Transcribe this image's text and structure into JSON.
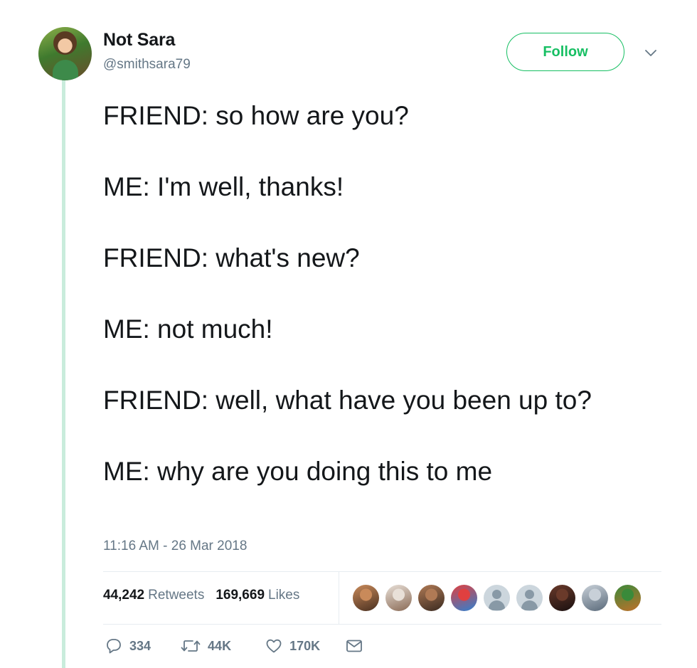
{
  "user": {
    "name": "Not Sara",
    "handle": "@smithsara79"
  },
  "follow_label": "Follow",
  "tweet": {
    "lines": [
      "FRIEND: so how are you?",
      "ME: I'm well, thanks!",
      "FRIEND: what's new?",
      "ME: not much!",
      "FRIEND: well, what have you been up to?",
      "ME: why are you doing this to me"
    ],
    "timestamp": "11:16 AM - 26 Mar 2018"
  },
  "stats": {
    "retweets_count": "44,242",
    "retweets_label": "Retweets",
    "likes_count": "169,669",
    "likes_label": "Likes"
  },
  "likers": [
    {
      "kind": "photo",
      "colors": [
        "#c98a5a",
        "#4a3020"
      ]
    },
    {
      "kind": "photo",
      "colors": [
        "#e8e0d8",
        "#8a6a55"
      ]
    },
    {
      "kind": "photo",
      "colors": [
        "#b07a55",
        "#3a2a20"
      ]
    },
    {
      "kind": "photo",
      "colors": [
        "#e04040",
        "#3080d0"
      ]
    },
    {
      "kind": "default"
    },
    {
      "kind": "default"
    },
    {
      "kind": "photo",
      "colors": [
        "#6a3a2a",
        "#1a1010"
      ]
    },
    {
      "kind": "photo",
      "colors": [
        "#c8d0d8",
        "#5a6a7a"
      ]
    },
    {
      "kind": "photo",
      "colors": [
        "#3a8a3a",
        "#c0702a"
      ]
    }
  ],
  "actions": {
    "replies": "334",
    "retweets": "44K",
    "likes": "170K"
  },
  "colors": {
    "accent": "#17bf63",
    "thread_line": "#c9ecdc",
    "secondary_text": "#657786"
  },
  "icons": {
    "reply": "reply-icon",
    "retweet": "retweet-icon",
    "like": "heart-icon",
    "dm": "envelope-icon",
    "menu": "chevron-down-icon"
  }
}
